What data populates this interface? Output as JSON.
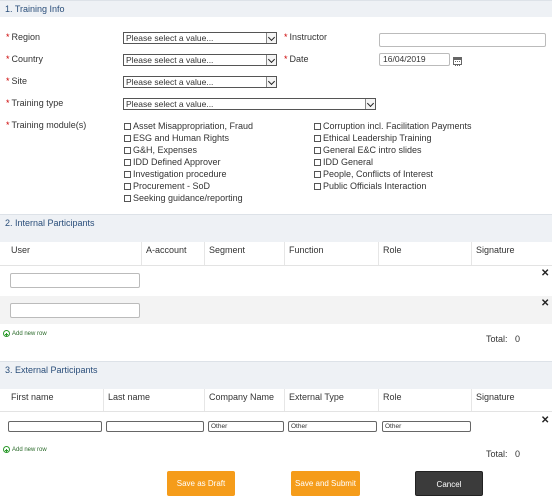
{
  "training_info": {
    "header": "1. Training Info",
    "region": {
      "label": "Region",
      "value": "Please select a value..."
    },
    "instructor": {
      "label": "Instructor",
      "value": ""
    },
    "country": {
      "label": "Country",
      "value": "Please select a value..."
    },
    "date": {
      "label": "Date",
      "value": "16/04/2019"
    },
    "site": {
      "label": "Site",
      "value": "Please select a value..."
    },
    "training_type": {
      "label": "Training type",
      "value": "Please select a value..."
    },
    "training_module": {
      "label": "Training module(s)",
      "left_options": [
        "Asset Misappropriation, Fraud",
        "ESG and Human Rights",
        "G&H, Expenses",
        "IDD Defined Approver",
        "Investigation procedure",
        "Procurement - SoD",
        "Seeking guidance/reporting"
      ],
      "right_options": [
        "Corruption incl. Facilitation Payments",
        "Ethical Leadership Training",
        "General E&C intro slides",
        "IDD General",
        "People, Conflicts of Interest",
        "Public Officials Interaction"
      ]
    }
  },
  "internal": {
    "header": "2. Internal Participants",
    "columns": [
      "User",
      "A-account",
      "Segment",
      "Function",
      "Role",
      "Signature"
    ],
    "close_glyph": "✕",
    "add_row": "Add new row",
    "total_label": "Total:",
    "total_value": "0"
  },
  "external": {
    "header": "3. External Participants",
    "columns": [
      "First name",
      "Last name",
      "Company Name",
      "External Type",
      "Role",
      "Signature"
    ],
    "row": {
      "first_name": "",
      "last_name": "",
      "company": "Other",
      "external_type": "Other",
      "role": "Other"
    },
    "close_glyph": "✕",
    "add_row": "Add new row",
    "total_label": "Total:",
    "total_value": "0"
  },
  "actions": {
    "save_draft": "Save as Draft",
    "save_submit": "Save and Submit",
    "cancel": "Cancel"
  },
  "colors": {
    "accent": "#f59c1a",
    "header_bg": "#eef1f5",
    "header_text": "#2a4e7a",
    "required": "#cc0000"
  }
}
